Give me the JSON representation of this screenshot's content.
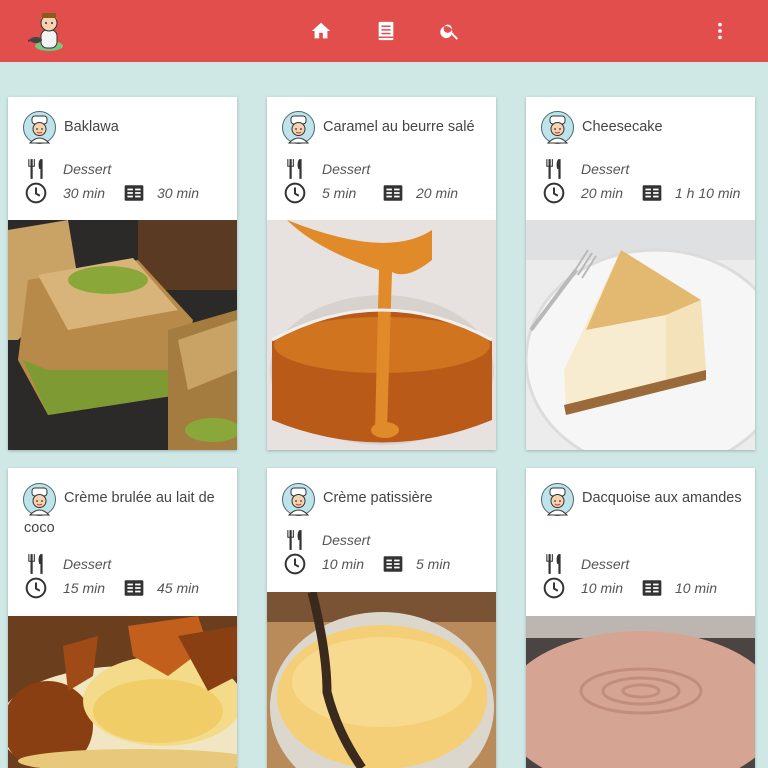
{
  "colors": {
    "topbar": "#e24e4b",
    "background": "#cfe8e6"
  },
  "nav": {
    "logo_icon": "cook-with-pan-logo",
    "items": [
      {
        "icon": "home-icon"
      },
      {
        "icon": "recipe-book-icon"
      },
      {
        "icon": "search-icon"
      },
      {
        "icon": "more-vert-icon"
      }
    ]
  },
  "recipes": [
    {
      "title": "Baklawa",
      "category": "Dessert",
      "prep": "30 min",
      "cook": "30 min"
    },
    {
      "title": "Caramel au beurre salé",
      "category": "Dessert",
      "prep": "5 min",
      "cook": "20 min"
    },
    {
      "title": "Cheesecake",
      "category": "Dessert",
      "prep": "20 min",
      "cook": "1 h 10 min"
    },
    {
      "title": "Crème brulée au lait de coco",
      "category": "Dessert",
      "prep": "15 min",
      "cook": "45 min"
    },
    {
      "title": "Crème patissière",
      "category": "Dessert",
      "prep": "10 min",
      "cook": "5 min"
    },
    {
      "title": "Dacquoise aux amandes",
      "category": "Dessert",
      "prep": "10 min",
      "cook": "10 min"
    }
  ]
}
